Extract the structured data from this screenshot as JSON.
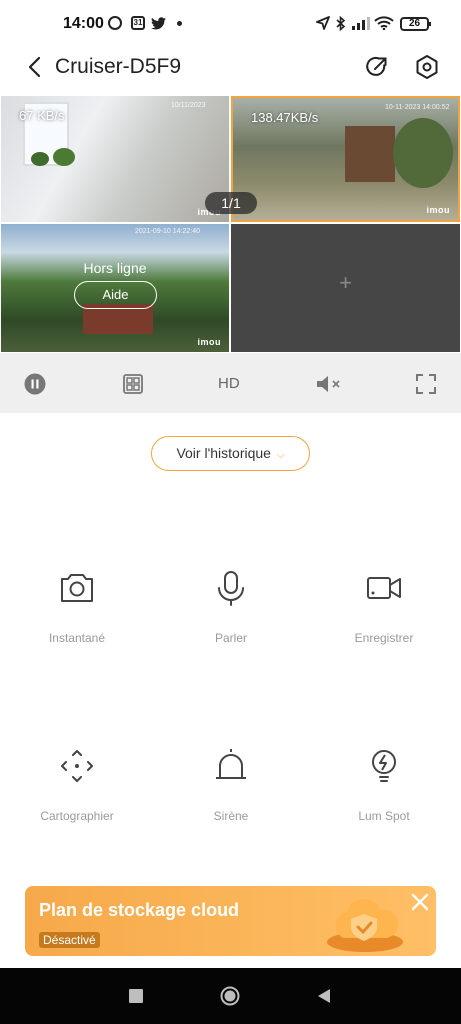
{
  "status_bar": {
    "time": "14:00",
    "calendar_day": "31",
    "battery": "26",
    "icons": [
      "clock-badge-icon",
      "calendar-icon",
      "twitter-icon",
      "dot-icon",
      "location-icon",
      "bluetooth-icon",
      "signal-icon",
      "wifi-icon",
      "battery-icon"
    ]
  },
  "header": {
    "title": "Cruiser-D5F9",
    "back_icon": "chevron-left-icon",
    "share_icon": "share-icon",
    "settings_icon": "settings-hexagon-icon"
  },
  "cameras": {
    "page_indicator": "1/1",
    "cam1": {
      "speed": "67   KB/s",
      "timestamp": "10/11/2023",
      "watermark": "imou"
    },
    "cam2": {
      "speed": "138.47KB/s",
      "timestamp": "10-11-2023 14:00:52",
      "watermark": "imou"
    },
    "cam3": {
      "timestamp": "2021-09-10 14:22:40",
      "status": "Hors ligne",
      "help_label": "Aide",
      "watermark": "imou"
    },
    "cam4": {
      "add_label": "+"
    }
  },
  "controls": {
    "pause_icon": "pause-icon",
    "grid_icon": "grid-icon",
    "quality_label": "HD",
    "mute_icon": "mute-icon",
    "fullscreen_icon": "fullscreen-icon"
  },
  "history_button": "Voir l'historique",
  "features": [
    {
      "label": "Instantané",
      "icon": "camera-icon"
    },
    {
      "label": "Parler",
      "icon": "microphone-icon"
    },
    {
      "label": "Enregistrer",
      "icon": "video-icon"
    },
    {
      "label": "Cartographier",
      "icon": "map-arrows-icon"
    },
    {
      "label": "Sirène",
      "icon": "siren-icon"
    },
    {
      "label": "Lum Spot",
      "icon": "spotlight-icon"
    }
  ],
  "banner": {
    "title": "Plan de stockage cloud",
    "badge": "Désactivé",
    "close_icon": "close-icon"
  },
  "colors": {
    "accent": "#f0a540",
    "banner_start": "#f6a94a",
    "banner_end": "#ffbf66",
    "controls_bg": "#efefef",
    "nav_bg": "#050505"
  }
}
